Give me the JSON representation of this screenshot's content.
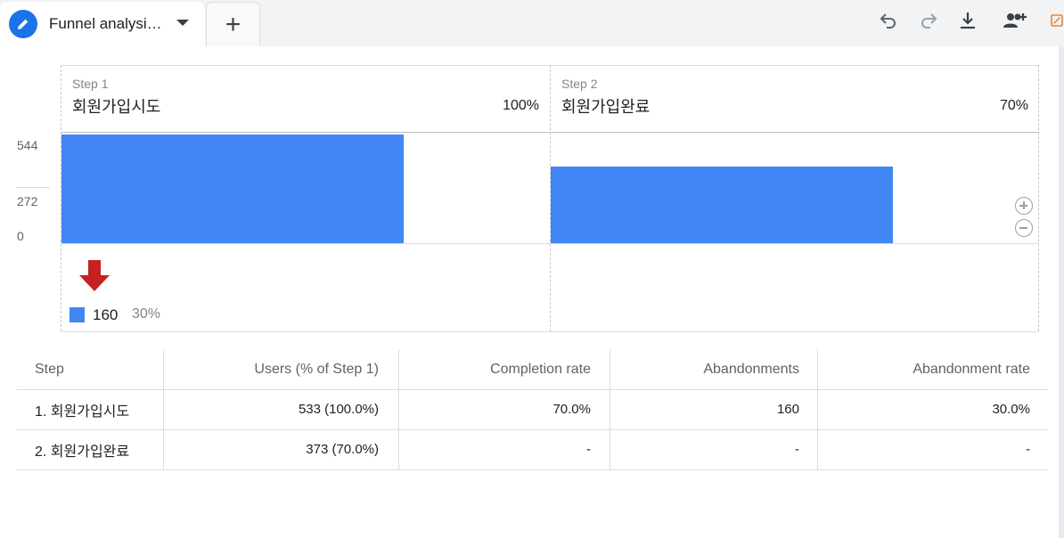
{
  "tabs": {
    "active_title": "Funnel analysi…",
    "add_label": "+"
  },
  "toolbar": {
    "icons": [
      "undo-icon",
      "redo-icon",
      "download-icon",
      "share-users-icon",
      "insights-icon"
    ]
  },
  "colors": {
    "accent": "#1a73e8",
    "bar": "#4285f4",
    "drop_arrow": "#c5221f",
    "insights": "#e8710a"
  },
  "funnel": {
    "steps": [
      {
        "label": "Step 1",
        "name": "회원가입시도",
        "pct": "100%",
        "users": 533
      },
      {
        "label": "Step 2",
        "name": "회원가입완료",
        "pct": "70%",
        "users": 373
      }
    ],
    "y_ticks": [
      "544",
      "272",
      "0"
    ],
    "y_max": 544,
    "dropoff": {
      "value": "160",
      "pct": "30%"
    }
  },
  "chart_data": {
    "type": "bar",
    "categories": [
      "회원가입시도",
      "회원가입완료"
    ],
    "values": [
      533,
      373
    ],
    "ylim": [
      0,
      544
    ],
    "title": "",
    "xlabel": "",
    "ylabel": ""
  },
  "table": {
    "headers": [
      "Step",
      "Users (% of Step 1)",
      "Completion rate",
      "Abandonments",
      "Abandonment rate"
    ],
    "rows": [
      [
        "1. 회원가입시도",
        "533 (100.0%)",
        "70.0%",
        "160",
        "30.0%"
      ],
      [
        "2. 회원가입완료",
        "373 (70.0%)",
        "-",
        "-",
        "-"
      ]
    ]
  }
}
